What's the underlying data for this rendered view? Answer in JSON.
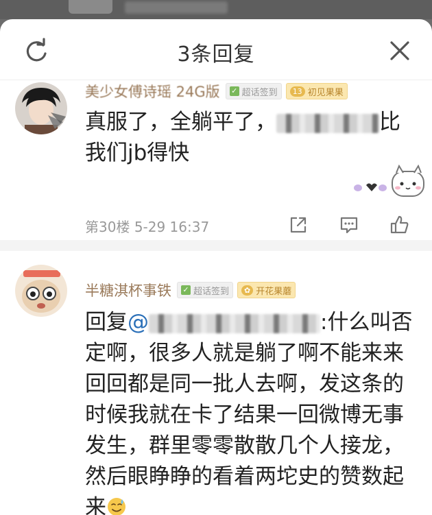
{
  "sheet": {
    "title": "3条回复"
  },
  "comments": [
    {
      "username": "美少女傅诗瑶 24G版",
      "sign_badge": "超话签到",
      "level_badge": {
        "level": "13",
        "label": "初见果果"
      },
      "text_before": "真服了，全躺平了，",
      "text_after": "比",
      "text_line2": "我们jb得快",
      "floor": "第30楼",
      "date": "5-29 16:37"
    },
    {
      "username": "半糖淇杯事铁",
      "sign_badge": "超话签到",
      "level_badge": {
        "label": "开花果蘑"
      },
      "reply_prefix": "回复",
      "mention": "@",
      "reply_rest": ":什么叫否定啊，很多人就是躺了啊不能来来回回都是同一批人去啊，发这条的时候我就在卡了结果一回微博无事发生，群里零零散散几个人接龙，然后眼睁睁的看着两坨史的赞数起来",
      "emoji": "sweat-smile-emoji"
    }
  ],
  "colors": {
    "username": "#9a7a5a",
    "mention": "#2a6fb8",
    "text": "#222222",
    "meta": "#999999"
  }
}
